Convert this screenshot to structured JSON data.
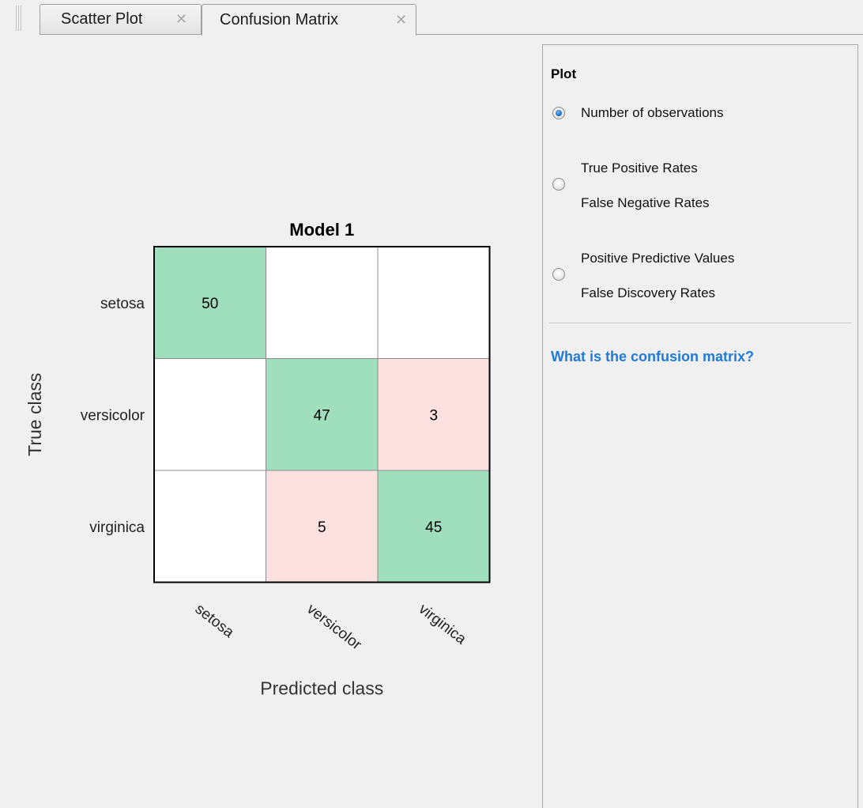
{
  "tabs": [
    {
      "label": "Scatter Plot",
      "close_glyph": "✕",
      "active": false
    },
    {
      "label": "Confusion Matrix",
      "close_glyph": "✕",
      "active": true
    }
  ],
  "panel": {
    "title": "Plot",
    "options": [
      {
        "lines": [
          "Number of observations"
        ],
        "selected": true
      },
      {
        "lines": [
          "True Positive Rates",
          "False Negative Rates"
        ],
        "selected": false
      },
      {
        "lines": [
          "Positive Predictive Values",
          "False Discovery Rates"
        ],
        "selected": false
      }
    ],
    "help_link": "What is the confusion matrix?"
  },
  "colors": {
    "correct": "#9fdfbd",
    "incorrect": "#fde0e0",
    "empty": "#ffffff",
    "link": "#1f7ad8"
  },
  "chart_data": {
    "type": "heatmap",
    "title": "Model 1",
    "xlabel": "Predicted class",
    "ylabel": "True class",
    "classes": [
      "setosa",
      "versicolor",
      "virginica"
    ],
    "matrix": [
      [
        50,
        null,
        null
      ],
      [
        null,
        47,
        3
      ],
      [
        null,
        5,
        45
      ]
    ]
  }
}
